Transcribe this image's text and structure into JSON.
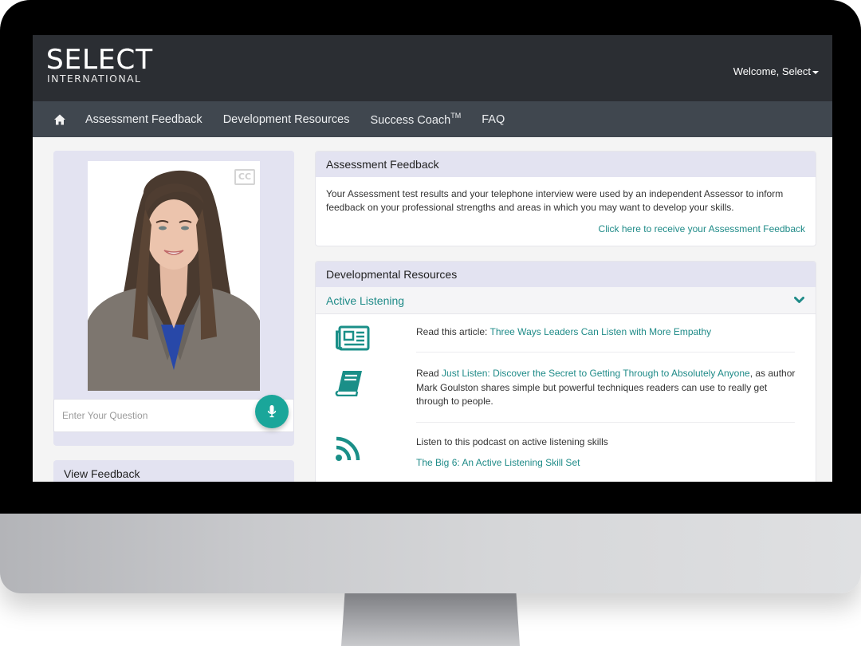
{
  "brand": {
    "logo_main": "SELECT",
    "logo_sub": "INTERNATIONAL"
  },
  "header": {
    "welcome": "Welcome, Select"
  },
  "nav": {
    "home_icon": "home-icon",
    "items": [
      {
        "label": "Assessment Feedback"
      },
      {
        "label": "Development Resources"
      },
      {
        "label": "Success Coach",
        "sup": "TM"
      },
      {
        "label": "FAQ"
      }
    ]
  },
  "avatar_panel": {
    "cc_label": "CC",
    "question_placeholder": "Enter Your Question",
    "mic_icon": "microphone-icon"
  },
  "view_feedback": {
    "title": "View Feedback"
  },
  "assessment_card": {
    "title": "Assessment Feedback",
    "body": "Your Assessment test results and your telephone interview were used by an independent Assessor to inform feedback on your professional strengths and areas in which you may want to develop your skills.",
    "link": "Click here to receive your Assessment Feedback"
  },
  "dev_card": {
    "title": "Developmental Resources",
    "accordion_title": "Active Listening",
    "resources": [
      {
        "icon": "newspaper-icon",
        "prefix": "Read this article: ",
        "link": "Three Ways Leaders Can Listen with More Empathy",
        "suffix": ""
      },
      {
        "icon": "book-icon",
        "prefix": "Read ",
        "link": "Just Listen: Discover the Secret to Getting Through to Absolutely Anyone",
        "suffix": ", as author Mark Goulston shares simple but powerful techniques readers can use to really get through to people."
      },
      {
        "icon": "rss-icon",
        "prefix": "Listen to this podcast on active listening skills",
        "link": "The Big 6: An Active Listening Skill Set",
        "suffix": ""
      }
    ]
  },
  "colors": {
    "accent": "#1f8b88",
    "mic_button": "#1aa69a",
    "topbar": "#2b2e33",
    "navbar": "#40474f",
    "card_header": "#e3e3f1"
  }
}
